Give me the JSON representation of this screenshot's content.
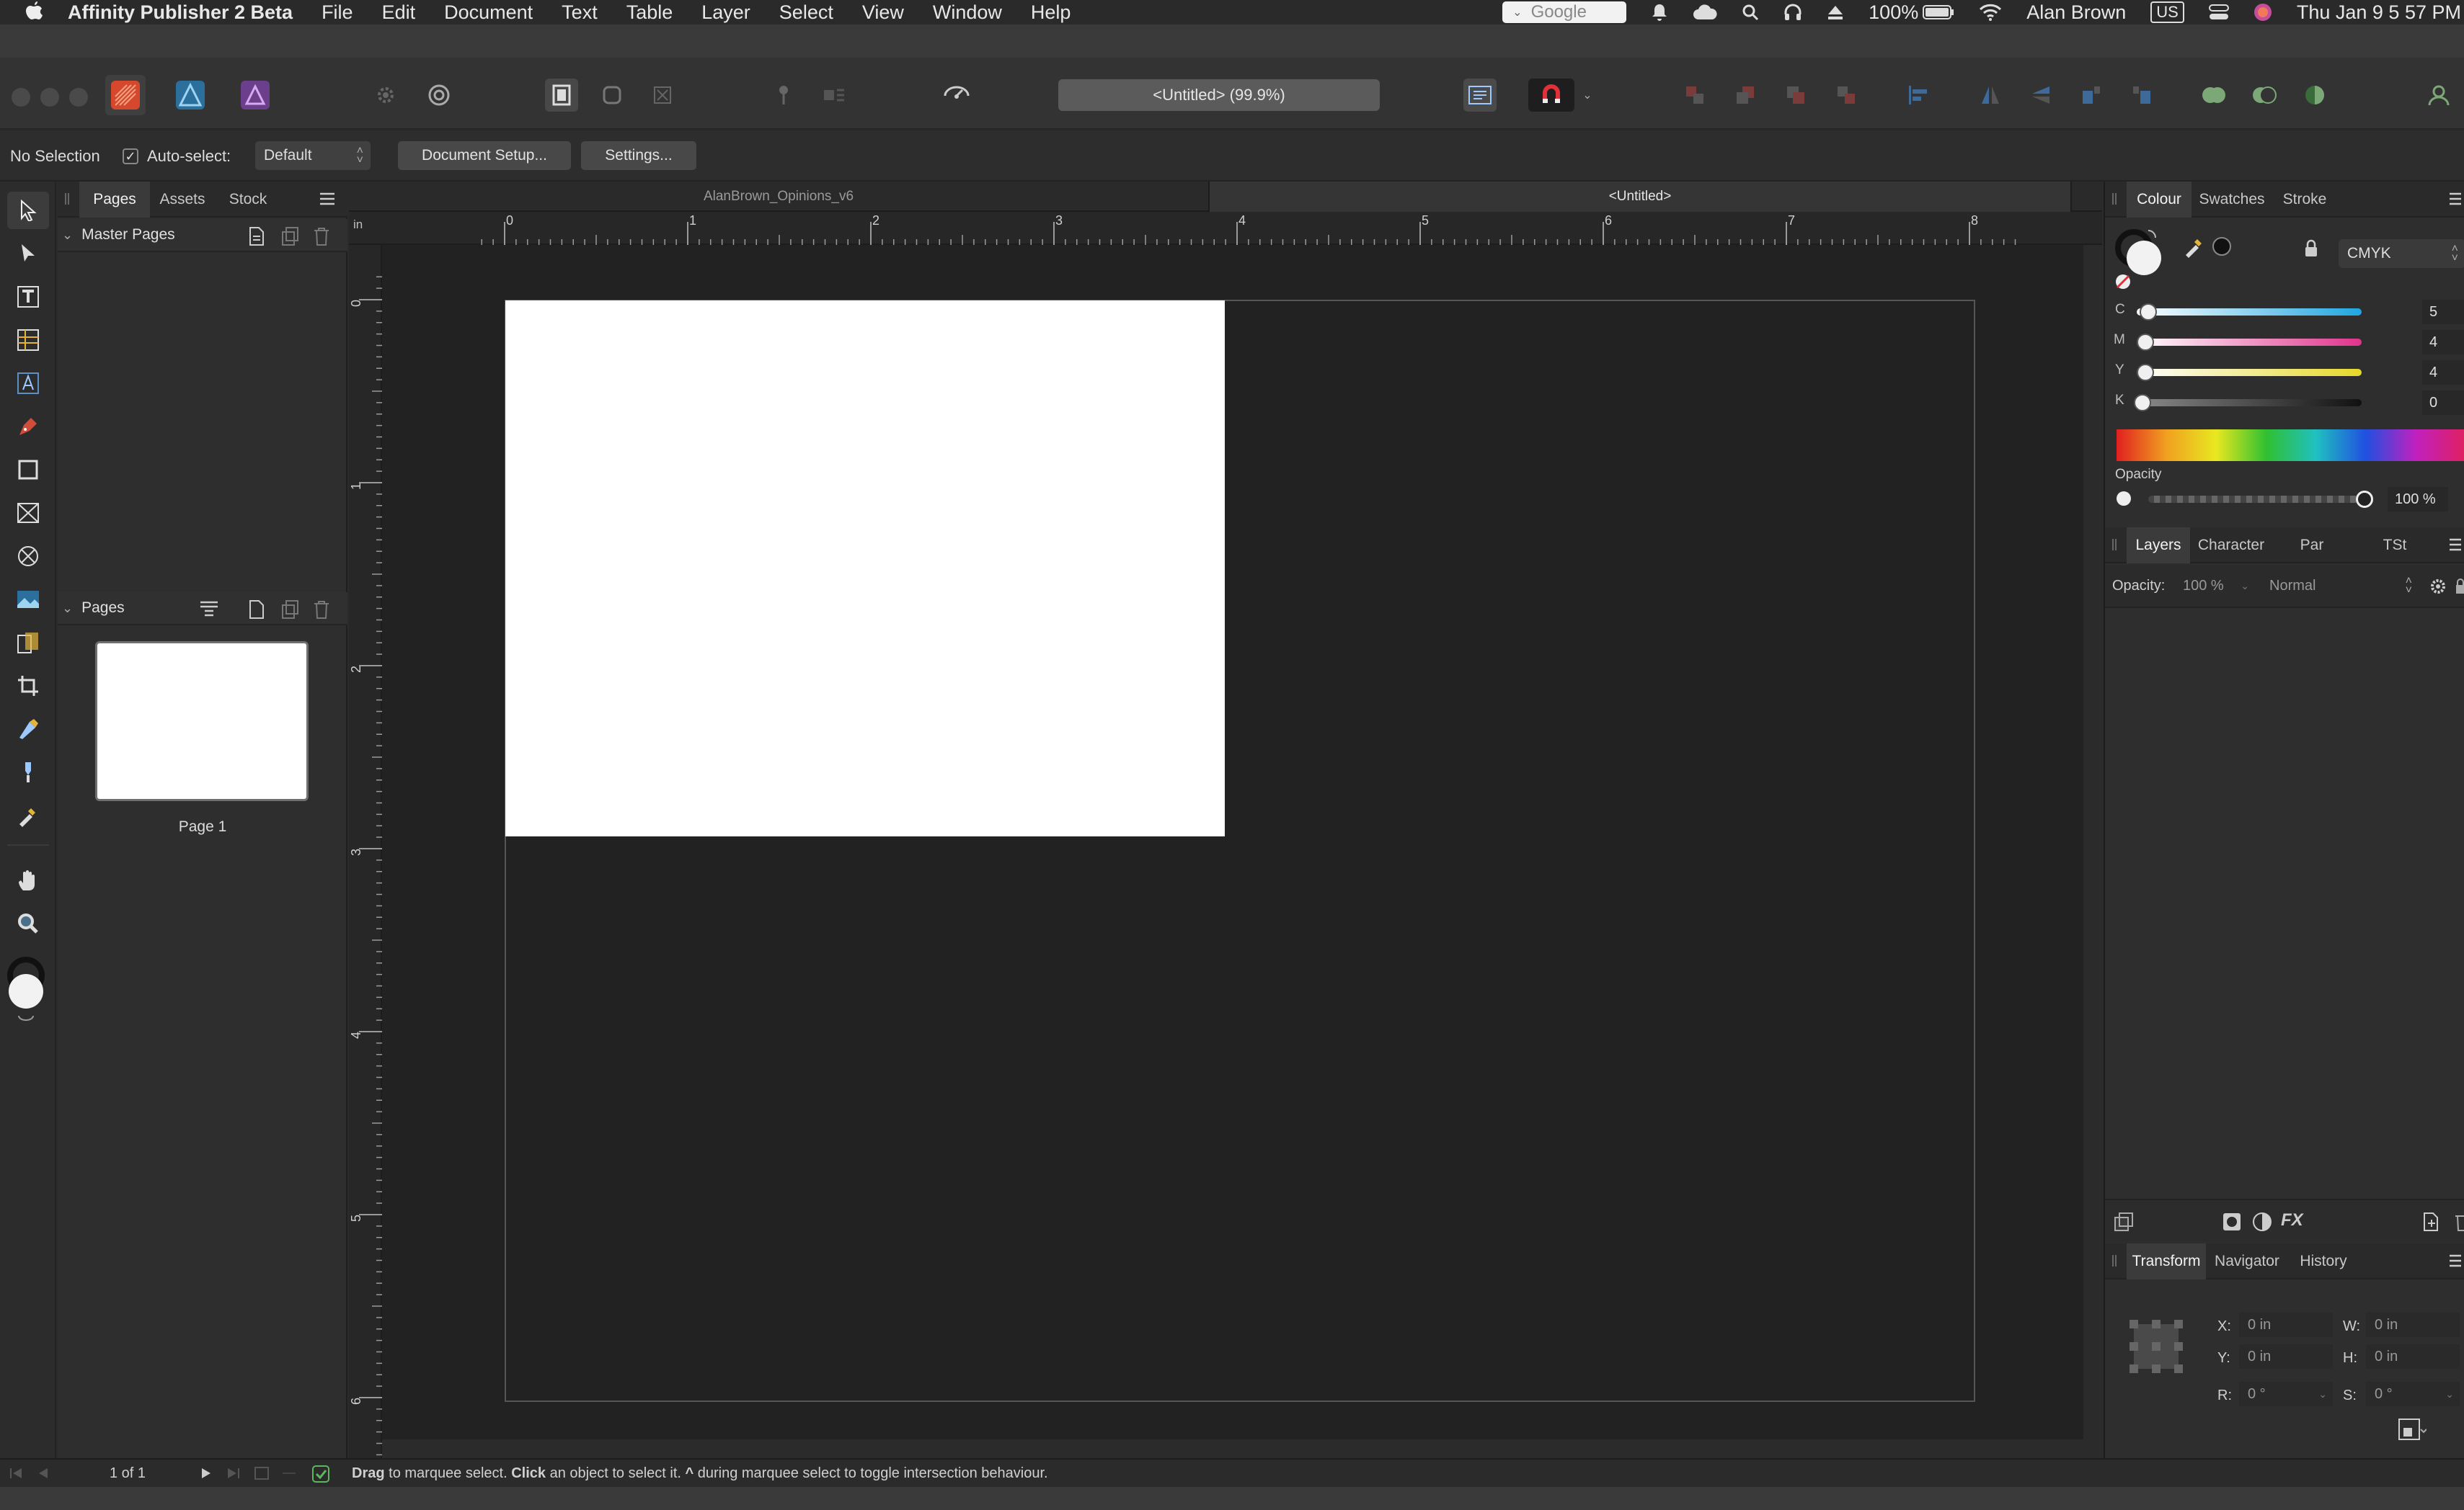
{
  "menubar": {
    "app_name": "Affinity Publisher 2 Beta",
    "menus": [
      "File",
      "Edit",
      "Document",
      "Text",
      "Table",
      "Layer",
      "Select",
      "View",
      "Window",
      "Help"
    ],
    "search_placeholder": "Google",
    "battery": "100%",
    "user": "Alan Brown",
    "input_source": "US",
    "clock": "Thu Jan 9  5 57 PM"
  },
  "toolbar": {
    "document_title": "<Untitled> (99.9%)"
  },
  "context": {
    "selection": "No Selection",
    "auto_select_label": "Auto-select:",
    "auto_select_checked": "✓",
    "auto_select_value": "Default",
    "document_setup": "Document Setup...",
    "settings": "Settings..."
  },
  "pages_panel": {
    "tabs": [
      "Pages",
      "Assets",
      "Stock"
    ],
    "master_pages": "Master Pages",
    "pages": "Pages",
    "page_label": "Page 1"
  },
  "doc_tabs": [
    "AlanBrown_Opinions_v6",
    "<Untitled>"
  ],
  "rulers": {
    "unit": "in",
    "h_labels": [
      "0",
      "1",
      "2",
      "3",
      "4",
      "5",
      "6",
      "7",
      "8"
    ],
    "v_labels": [
      "0",
      "1",
      "2",
      "3",
      "4",
      "5",
      "6"
    ]
  },
  "colour_panel": {
    "tabs": [
      "Colour",
      "Swatches",
      "Stroke"
    ],
    "model": "CMYK",
    "sliders": [
      {
        "label": "C",
        "value": "5",
        "fraction": 0.05
      },
      {
        "label": "M",
        "value": "4",
        "fraction": 0.04
      },
      {
        "label": "Y",
        "value": "4",
        "fraction": 0.04
      },
      {
        "label": "K",
        "value": "0",
        "fraction": 0.0
      }
    ],
    "opacity_label": "Opacity",
    "opacity_value": "100 %",
    "opacity_fraction": 1.0,
    "colors": {
      "cyan": "#1fa6e0",
      "magenta": "#e0338c",
      "yellow": "#e6d82a",
      "black": "#111111"
    }
  },
  "layers_panel": {
    "tabs": [
      "Layers",
      "Character",
      "Par",
      "TSt"
    ],
    "opacity_label": "Opacity:",
    "opacity_value": "100 %",
    "blend_mode": "Normal"
  },
  "transform_panel": {
    "tabs": [
      "Transform",
      "Navigator",
      "History"
    ],
    "x_label": "X:",
    "x_value": "0 in",
    "y_label": "Y:",
    "y_value": "0 in",
    "w_label": "W:",
    "w_value": "0 in",
    "h_label": "H:",
    "h_value": "0 in",
    "r_label": "R:",
    "r_value": "0 °",
    "s_label": "S:",
    "s_value": "0 °"
  },
  "statusbar": {
    "page_counter": "1 of 1",
    "hint_drag": "Drag",
    "hint_1": " to marquee select. ",
    "hint_click": "Click",
    "hint_2": " an object to select it. ",
    "hint_caret": "^",
    "hint_3": " during marquee select to toggle intersection behaviour."
  }
}
